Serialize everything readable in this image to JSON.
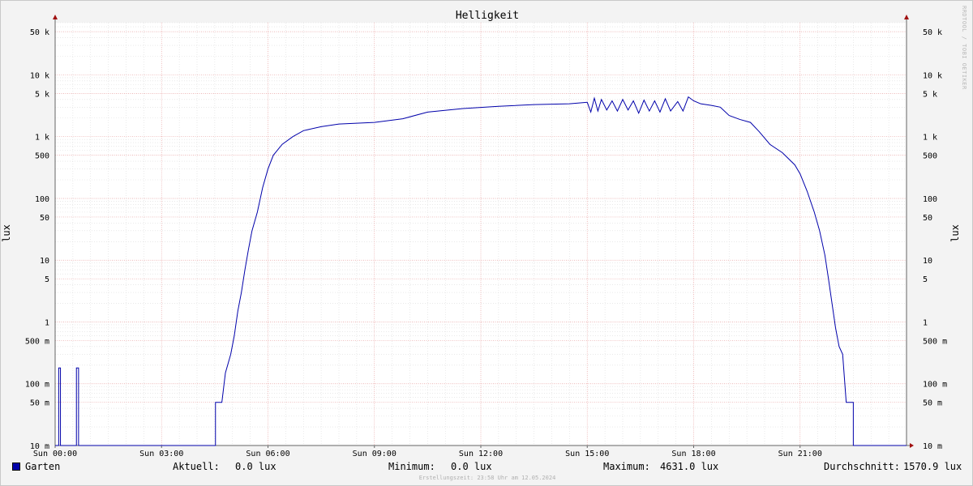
{
  "title": "Helligkeit",
  "watermark": "RRDTOOL / TOBI OETIKER",
  "ylabel": "lux",
  "legend": {
    "series_name": "Garten",
    "color": "#0000aa",
    "aktuell_label": "Aktuell:",
    "aktuell_value": "0.0 lux",
    "minimum_label": "Minimum:",
    "minimum_value": "0.0 lux",
    "maximum_label": "Maximum:",
    "maximum_value": "4631.0 lux",
    "durchschnitt_label": "Durchschnitt:",
    "durchschnitt_value": "1570.9 lux"
  },
  "credit": "Erstellungszeit: 23:58 Uhr am 12.05.2024",
  "chart_data": {
    "type": "line",
    "title": "Helligkeit",
    "ylabel": "lux",
    "yscale": "log",
    "ylim": [
      0.01,
      70000
    ],
    "xlim_hours": [
      0,
      24
    ],
    "grid": true,
    "legend_position": "bottom",
    "x_ticks": [
      {
        "hour": 0,
        "label": "Sun 00:00"
      },
      {
        "hour": 3,
        "label": "Sun 03:00"
      },
      {
        "hour": 6,
        "label": "Sun 06:00"
      },
      {
        "hour": 9,
        "label": "Sun 09:00"
      },
      {
        "hour": 12,
        "label": "Sun 12:00"
      },
      {
        "hour": 15,
        "label": "Sun 15:00"
      },
      {
        "hour": 18,
        "label": "Sun 18:00"
      },
      {
        "hour": 21,
        "label": "Sun 21:00"
      }
    ],
    "y_ticks": [
      {
        "value": 0.01,
        "label": "10 m"
      },
      {
        "value": 0.05,
        "label": "50 m"
      },
      {
        "value": 0.1,
        "label": "100 m"
      },
      {
        "value": 0.5,
        "label": "500 m"
      },
      {
        "value": 1,
        "label": "1"
      },
      {
        "value": 5,
        "label": "5"
      },
      {
        "value": 10,
        "label": "10"
      },
      {
        "value": 50,
        "label": "50"
      },
      {
        "value": 100,
        "label": "100"
      },
      {
        "value": 500,
        "label": "500"
      },
      {
        "value": 1000,
        "label": "1 k"
      },
      {
        "value": 5000,
        "label": "5 k"
      },
      {
        "value": 10000,
        "label": "10 k"
      },
      {
        "value": 50000,
        "label": "50 k"
      }
    ],
    "series": [
      {
        "name": "Garten",
        "color": "#0000aa",
        "points": [
          [
            0.0,
            0.01
          ],
          [
            0.1,
            0.01
          ],
          [
            0.1,
            0.18
          ],
          [
            0.15,
            0.18
          ],
          [
            0.15,
            0.01
          ],
          [
            0.6,
            0.01
          ],
          [
            0.6,
            0.18
          ],
          [
            0.66,
            0.18
          ],
          [
            0.66,
            0.01
          ],
          [
            4.52,
            0.01
          ],
          [
            4.52,
            0.05
          ],
          [
            4.7,
            0.05
          ],
          [
            4.8,
            0.15
          ],
          [
            4.95,
            0.3
          ],
          [
            5.05,
            0.6
          ],
          [
            5.15,
            1.5
          ],
          [
            5.25,
            3
          ],
          [
            5.35,
            7
          ],
          [
            5.45,
            15
          ],
          [
            5.55,
            30
          ],
          [
            5.7,
            60
          ],
          [
            5.85,
            150
          ],
          [
            6.0,
            300
          ],
          [
            6.15,
            500
          ],
          [
            6.4,
            750
          ],
          [
            6.7,
            1000
          ],
          [
            7.0,
            1250
          ],
          [
            7.5,
            1450
          ],
          [
            8.0,
            1600
          ],
          [
            9.0,
            1700
          ],
          [
            9.8,
            1950
          ],
          [
            10.5,
            2500
          ],
          [
            11.5,
            2850
          ],
          [
            12.5,
            3100
          ],
          [
            13.5,
            3300
          ],
          [
            14.5,
            3400
          ],
          [
            15.0,
            3600
          ],
          [
            15.1,
            2500
          ],
          [
            15.2,
            4200
          ],
          [
            15.3,
            2600
          ],
          [
            15.4,
            4000
          ],
          [
            15.55,
            2700
          ],
          [
            15.7,
            3800
          ],
          [
            15.85,
            2600
          ],
          [
            16.0,
            4000
          ],
          [
            16.15,
            2700
          ],
          [
            16.3,
            3800
          ],
          [
            16.45,
            2400
          ],
          [
            16.6,
            3900
          ],
          [
            16.75,
            2600
          ],
          [
            16.9,
            3800
          ],
          [
            17.05,
            2500
          ],
          [
            17.2,
            4100
          ],
          [
            17.35,
            2600
          ],
          [
            17.55,
            3700
          ],
          [
            17.7,
            2600
          ],
          [
            17.85,
            4400
          ],
          [
            18.0,
            3800
          ],
          [
            18.2,
            3400
          ],
          [
            18.5,
            3200
          ],
          [
            18.75,
            3000
          ],
          [
            19.0,
            2200
          ],
          [
            19.3,
            1900
          ],
          [
            19.6,
            1700
          ],
          [
            19.85,
            1200
          ],
          [
            20.15,
            750
          ],
          [
            20.5,
            550
          ],
          [
            20.85,
            350
          ],
          [
            21.0,
            250
          ],
          [
            21.2,
            130
          ],
          [
            21.4,
            60
          ],
          [
            21.55,
            30
          ],
          [
            21.7,
            12
          ],
          [
            21.8,
            5
          ],
          [
            21.9,
            2
          ],
          [
            22.0,
            0.8
          ],
          [
            22.1,
            0.4
          ],
          [
            22.2,
            0.3
          ],
          [
            22.3,
            0.05
          ],
          [
            22.5,
            0.05
          ],
          [
            22.5,
            0.01
          ],
          [
            24.0,
            0.01
          ]
        ]
      }
    ]
  }
}
